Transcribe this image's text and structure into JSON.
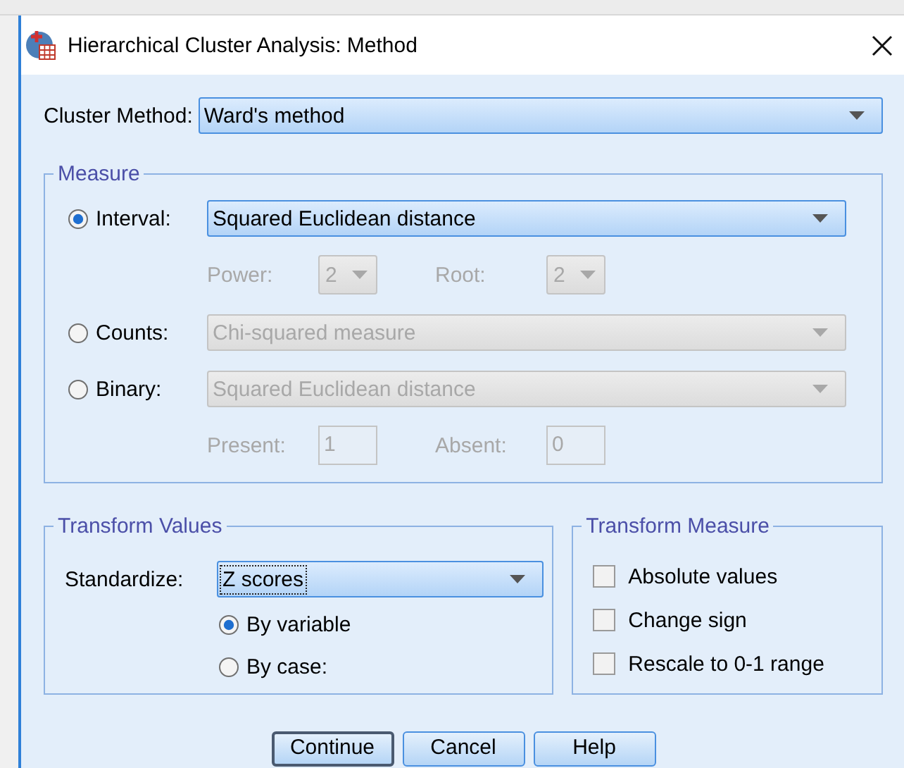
{
  "window": {
    "title": "Hierarchical Cluster Analysis: Method"
  },
  "cluster_method": {
    "label": "Cluster Method:",
    "value": "Ward's method",
    "disabled": false
  },
  "measure": {
    "title": "Measure",
    "options": [
      {
        "label": "Interval:",
        "selected": true,
        "value": "Squared Euclidean distance",
        "disabled": false,
        "params": [
          {
            "kind": "dropdown",
            "label": "Power:",
            "value": "2",
            "disabled": true
          },
          {
            "kind": "dropdown",
            "label": "Root:",
            "value": "2",
            "disabled": true
          }
        ]
      },
      {
        "label": "Counts:",
        "selected": false,
        "value": "Chi-squared measure",
        "disabled": true
      },
      {
        "label": "Binary:",
        "selected": false,
        "value": "Squared Euclidean distance",
        "disabled": true,
        "params": [
          {
            "kind": "field",
            "label": "Present:",
            "value": "1",
            "disabled": true
          },
          {
            "kind": "field",
            "label": "Absent:",
            "value": "0",
            "disabled": true
          }
        ]
      }
    ]
  },
  "transform_values": {
    "title": "Transform Values",
    "label": "Standardize:",
    "value": "Z scores",
    "focused": true,
    "options": [
      {
        "label": "By variable",
        "selected": true
      },
      {
        "label": "By case:",
        "selected": false
      }
    ]
  },
  "transform_measure": {
    "title": "Transform Measure",
    "options": [
      {
        "label": "Absolute values",
        "checked": false
      },
      {
        "label": "Change sign",
        "checked": false
      },
      {
        "label": "Rescale to 0-1 range",
        "checked": false
      }
    ]
  },
  "buttons": [
    {
      "label": "Continue",
      "focused": true
    },
    {
      "label": "Cancel",
      "focused": false
    },
    {
      "label": "Help",
      "focused": false
    }
  ]
}
